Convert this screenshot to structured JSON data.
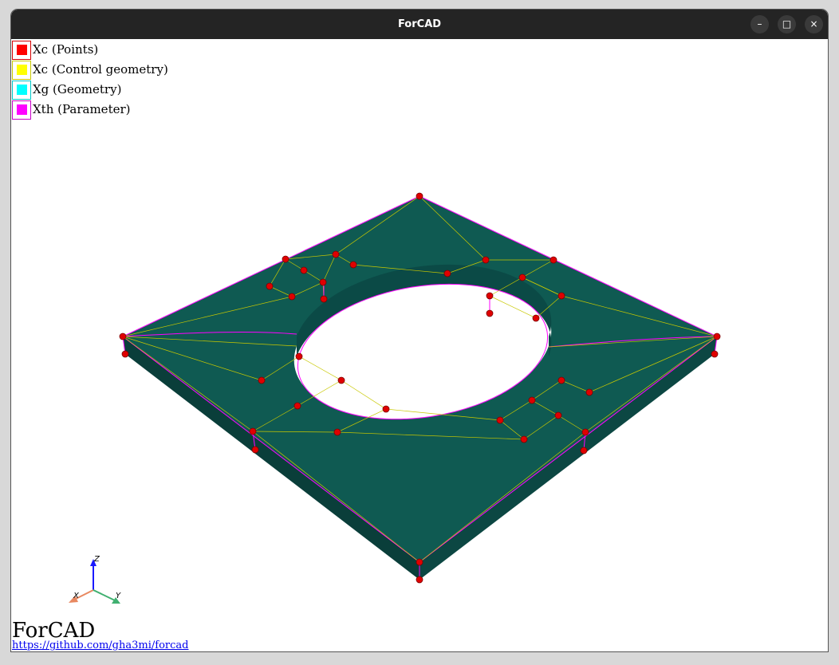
{
  "window": {
    "title": "ForCAD"
  },
  "controls": {
    "minimize": "–",
    "maximize": "□",
    "close": "×"
  },
  "legend": [
    {
      "label": "Xc (Points)",
      "border": "#d40000",
      "fill": "#ff0000"
    },
    {
      "label": "Xc (Control geometry)",
      "border": "#c8c800",
      "fill": "#ffff00"
    },
    {
      "label": "Xg (Geometry)",
      "border": "#00c8c8",
      "fill": "#00ffff"
    },
    {
      "label": "Xth (Parameter)",
      "border": "#c800c8",
      "fill": "#ff00ff"
    }
  ],
  "axes": {
    "x": "X",
    "y": "Y",
    "z": "Z"
  },
  "footer": {
    "brand": "ForCAD",
    "link": "https://github.com/gha3mi/forcad"
  },
  "colors": {
    "surface": "#0f5a52",
    "side": "#0a3e3a",
    "points": "#e00000",
    "control": "#d8d800",
    "parameter": "#ff00ff"
  }
}
